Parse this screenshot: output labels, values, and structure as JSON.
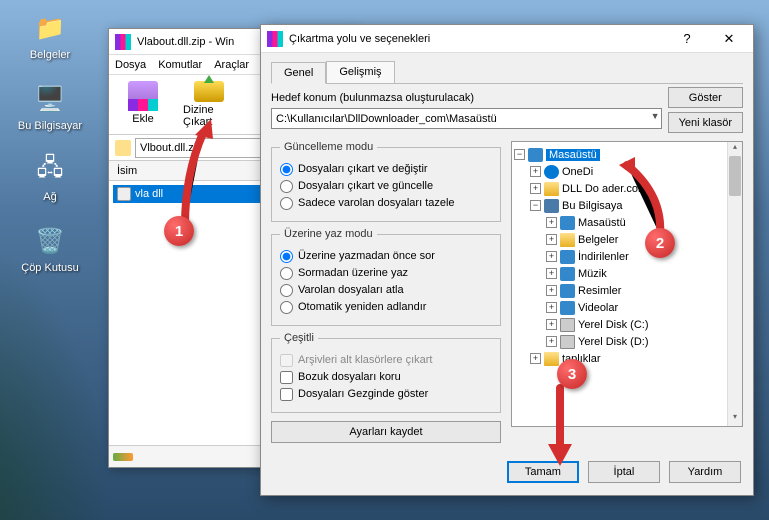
{
  "desktop_icons": {
    "documents": "Belgeler",
    "computer": "Bu Bilgisayar",
    "network": "Ağ",
    "recycle": "Çöp Kutusu"
  },
  "winrar": {
    "title": "Vlabout.dll.zip - Win",
    "menu": {
      "file": "Dosya",
      "commands": "Komutlar",
      "tools": "Araçlar"
    },
    "toolbar": {
      "add": "Ekle",
      "extract": "Dizine Çıkart"
    },
    "path_value": "Vlbout.dll.zi",
    "list_header": "İsim",
    "file_name": "vla       dll"
  },
  "extract": {
    "title": "Çıkartma yolu ve seçenekleri",
    "close_btn": "✕",
    "tabs": {
      "general": "Genel",
      "advanced": "Gelişmiş"
    },
    "path_label": "Hedef konum (bulunmazsa oluşturulacak)",
    "path_value": "C:\\Kullanıcılar\\DllDownloader_com\\Masaüstü",
    "btn_show": "Göster",
    "btn_newfolder": "Yeni klasör",
    "groups": {
      "update": {
        "legend": "Güncelleme modu",
        "r1": "Dosyaları çıkart ve değiştir",
        "r2": "Dosyaları çıkart ve güncelle",
        "r3": "Sadece varolan dosyaları tazele"
      },
      "overwrite": {
        "legend": "Üzerine yaz modu",
        "r1": "Üzerine yazmadan önce sor",
        "r2": "Sormadan üzerine yaz",
        "r3": "Varolan dosyaları atla",
        "r4": "Otomatik yeniden adlandır"
      },
      "misc": {
        "legend": "Çeşitli",
        "c1": "Arşivleri alt klasörlere çıkart",
        "c2": "Bozuk dosyaları koru",
        "c3": "Dosyaları Gezginde göster"
      }
    },
    "save_settings": "Ayarları kaydet",
    "tree": {
      "desktop": "Masaüstü",
      "onedrive": "OneDi",
      "dll_folder": "DLL Do       ader.com",
      "this_pc": "Bu Bilgisaya",
      "pc_desktop": "Masaüstü",
      "documents": "Belgeler",
      "downloads": "İndirilenler",
      "music": "Müzik",
      "pictures": "Resimler",
      "videos": "Videolar",
      "disk_c": "Yerel Disk (C:)",
      "disk_d": "Yerel Disk (D:)",
      "libraries": "taplıklar"
    },
    "footer": {
      "ok": "Tamam",
      "cancel": "İptal",
      "help": "Yardım"
    }
  },
  "callouts": {
    "c1": "1",
    "c2": "2",
    "c3": "3"
  }
}
